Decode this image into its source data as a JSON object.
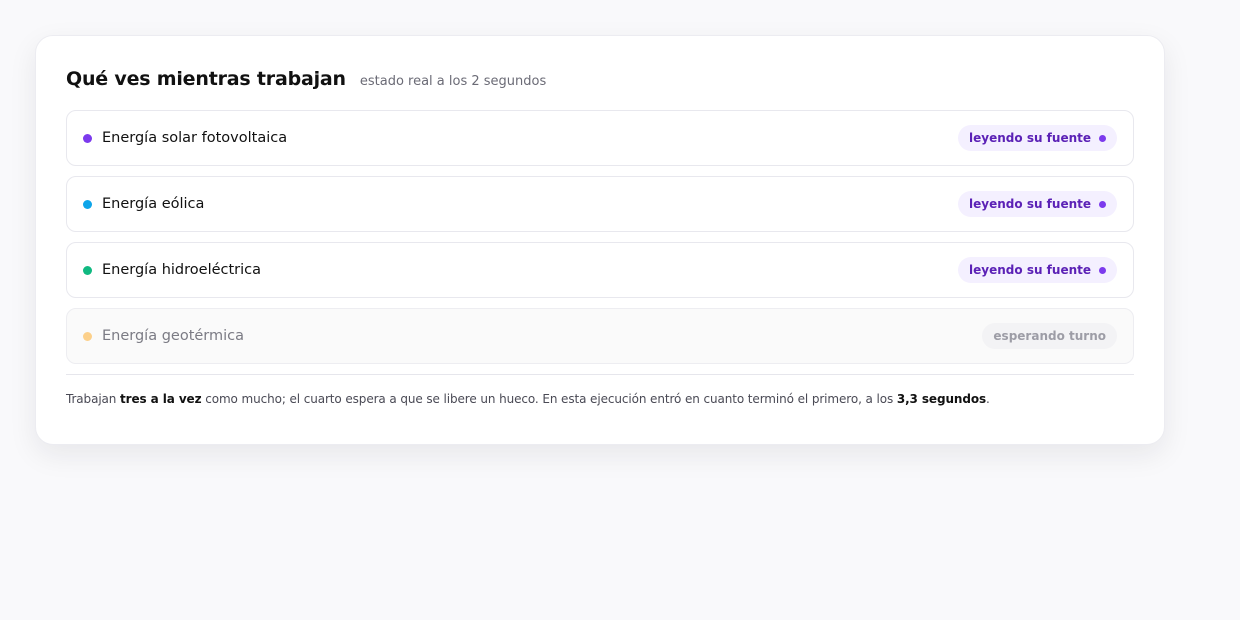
{
  "header": {
    "title": "Qué ves mientras trabajan",
    "subtitle": "estado real a los 2 segundos"
  },
  "colors": {
    "active_badge_text": "#5b21b6",
    "active_badge_bg": "#f4f0ff",
    "status_dot": "#7c3aed"
  },
  "rows": [
    {
      "label": "Energía solar fotovoltaica",
      "dot_color": "#7c3aed",
      "status": "leyendo su fuente",
      "state": "active"
    },
    {
      "label": "Energía eólica",
      "dot_color": "#0ea5e9",
      "status": "leyendo su fuente",
      "state": "active"
    },
    {
      "label": "Energía hidroeléctrica",
      "dot_color": "#10b981",
      "status": "leyendo su fuente",
      "state": "active"
    },
    {
      "label": "Energía geotérmica",
      "dot_color": "#fcd08a",
      "status": "esperando turno",
      "state": "waiting"
    }
  ],
  "footnote": {
    "part1": "Trabajan ",
    "bold1": "tres a la vez",
    "part2": " como mucho; el cuarto espera a que se libere un hueco. En esta ejecución entró en cuanto terminó el primero, a los ",
    "bold2": "3,3 segundos",
    "part3": "."
  }
}
